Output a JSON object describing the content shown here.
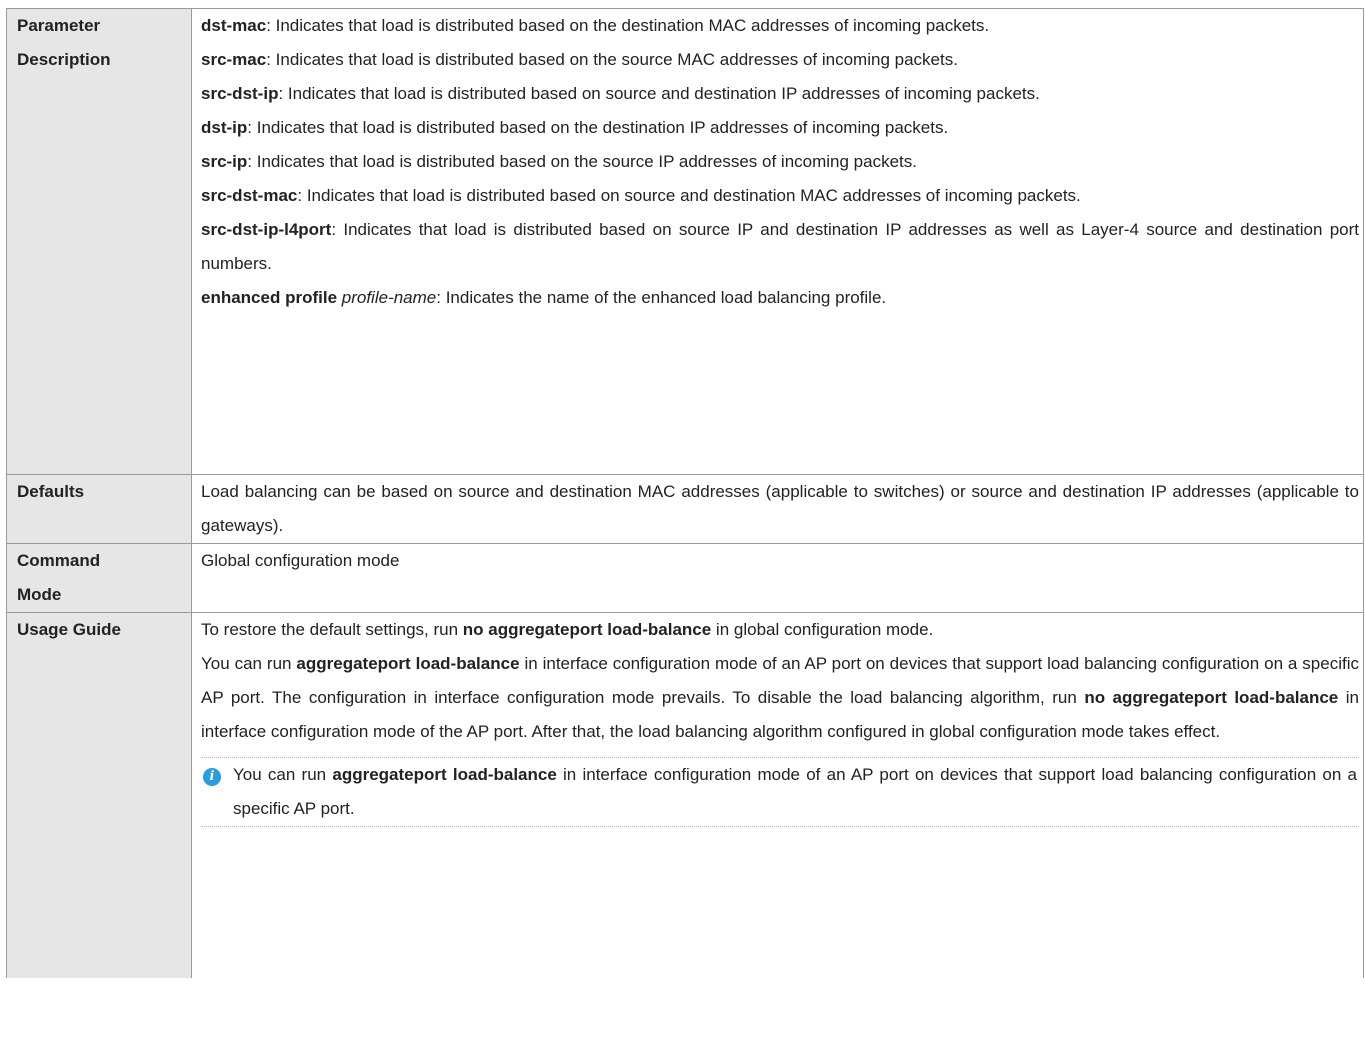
{
  "rows": {
    "parameter": {
      "label_line1": "Parameter",
      "label_line2": "Description",
      "items": [
        {
          "term": "dst-mac",
          "text": ": Indicates that load is distributed based on the destination MAC addresses of incoming packets."
        },
        {
          "term": "src-mac",
          "text": ": Indicates that load is distributed based on the source MAC addresses of incoming packets."
        },
        {
          "term": "src-dst-ip",
          "text": ": Indicates that load is distributed based on source and destination IP addresses of incoming packets."
        },
        {
          "term": "dst-ip",
          "text": ": Indicates that load is distributed based on the destination IP addresses of incoming packets."
        },
        {
          "term": "src-ip",
          "text": ": Indicates that load is distributed based on the source IP addresses of incoming packets."
        },
        {
          "term": "src-dst-mac",
          "text": ": Indicates that load is distributed based on source and destination MAC addresses of incoming packets."
        },
        {
          "term": "src-dst-ip-l4port",
          "text": ": Indicates that load is distributed based on source IP and destination IP addresses as well as Layer-4 source and destination port numbers."
        },
        {
          "term": "enhanced profile",
          "arg": "profile-name",
          "text": ": Indicates the name of the enhanced load balancing profile."
        }
      ]
    },
    "defaults": {
      "label": "Defaults",
      "text": "Load balancing can be based on source and destination MAC addresses (applicable to switches) or source and destination IP addresses (applicable to gateways)."
    },
    "command_mode": {
      "label_line1": "Command",
      "label_line2": "Mode",
      "text": "Global configuration mode"
    },
    "usage_guide": {
      "label": "Usage Guide",
      "p1_before": "To restore the default settings, run ",
      "p1_cmd": "no aggregateport load-balance",
      "p1_after": " in global configuration mode.",
      "p2_a": "You can run ",
      "p2_cmd1": "aggregateport load-balance",
      "p2_b": " in interface configuration mode of an AP port on devices that support load balancing configuration on a specific AP port. The configuration in interface configuration mode prevails. To disable the load balancing algorithm, run ",
      "p2_cmd2": "no aggregateport load-balance",
      "p2_c": " in interface configuration mode of the AP port. After that, the load balancing algorithm configured in global configuration mode takes effect.",
      "note_a": "You can run ",
      "note_cmd": "aggregateport load-balance",
      "note_b": " in interface configuration mode of an AP port on devices that support load balancing configuration on a specific AP port."
    }
  },
  "colors": {
    "label_bg": "#e6e6e6",
    "border": "#9a9a9a",
    "info_icon": "#2a9ddb"
  },
  "icons": {
    "note": "info-icon"
  }
}
